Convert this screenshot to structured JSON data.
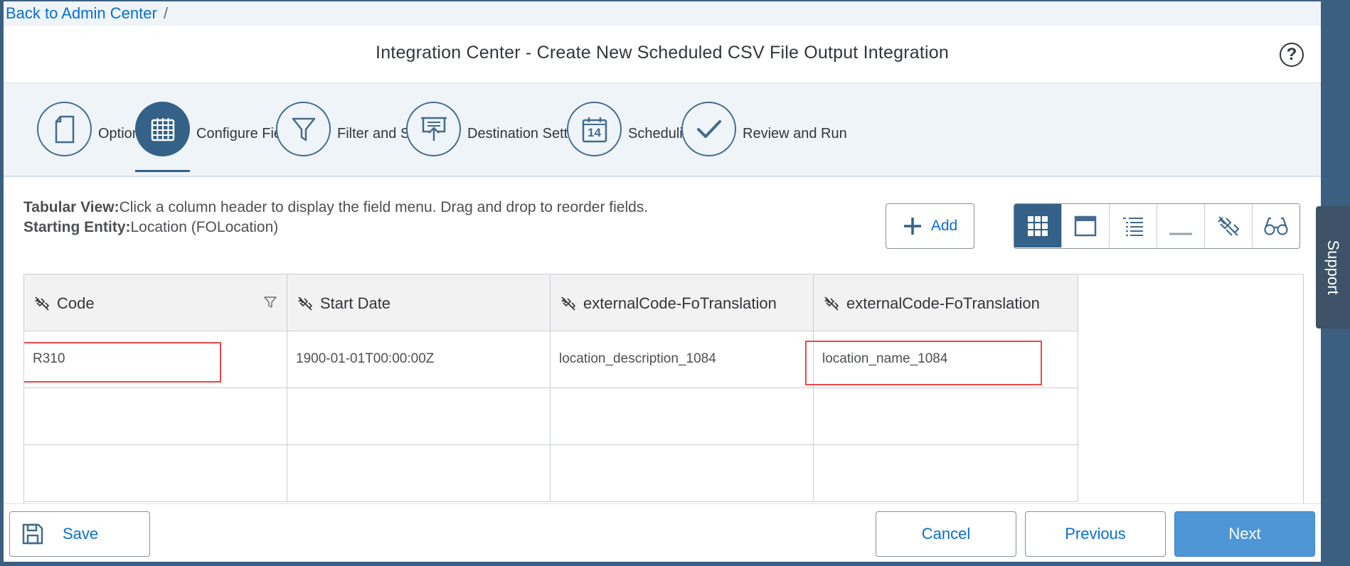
{
  "breadcrumb": {
    "back_link": "Back to Admin Center",
    "separator": "/"
  },
  "header": {
    "title": "Integration Center - Create New Scheduled CSV File Output Integration",
    "help_icon": "?"
  },
  "steps": [
    {
      "label": "Options",
      "icon": "document-icon",
      "active": false
    },
    {
      "label": "Configure Fields",
      "icon": "grid-icon",
      "active": true
    },
    {
      "label": "Filter and Sort",
      "icon": "filter-icon",
      "active": false
    },
    {
      "label": "Destination Settings",
      "icon": "upload-icon",
      "active": false
    },
    {
      "label": "Scheduling",
      "icon": "calendar-icon",
      "active": false,
      "calendar_day": "14"
    },
    {
      "label": "Review and Run",
      "icon": "checkmark-icon",
      "active": false
    }
  ],
  "description": {
    "tabular_label": "Tabular View:",
    "tabular_text": "Click a column header to display the field menu. Drag and drop to reorder fields.",
    "entity_label": "Starting Entity:",
    "entity_text": "Location (FOLocation)"
  },
  "toolbar": {
    "add_label": "Add",
    "views": [
      "grid-view-icon",
      "detail-view-icon",
      "list-view-icon",
      "minimize-icon",
      "unlink-icon",
      "preview-icon"
    ]
  },
  "table": {
    "columns": [
      "Code",
      "Start Date",
      "externalCode-FoTranslation",
      "externalCode-FoTranslation"
    ],
    "rows": [
      [
        "R310",
        "1900-01-01T00:00:00Z",
        "location_description_1084",
        "location_name_1084"
      ],
      [
        "",
        "",
        "",
        ""
      ],
      [
        "",
        "",
        "",
        ""
      ]
    ]
  },
  "footer": {
    "save": "Save",
    "cancel": "Cancel",
    "previous": "Previous",
    "next": "Next"
  },
  "support": {
    "label": "Support"
  },
  "colors": {
    "accent": "#346187",
    "link": "#0a6ed1",
    "primary_button": "#4e96d6",
    "highlight": "#e8474b"
  }
}
